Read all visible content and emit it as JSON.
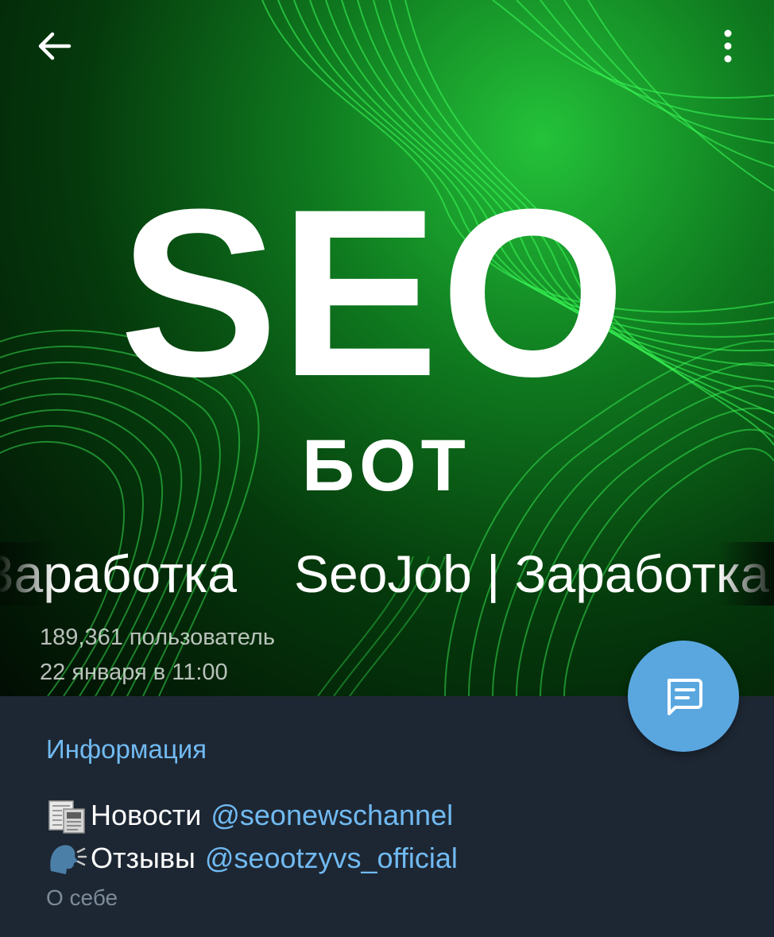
{
  "header": {
    "logo_main": "SEO",
    "logo_sub": "БОТ",
    "title": "SeoJob | Заработка",
    "subscribers": "189,361 пользователь",
    "last_seen": "22 января в 11:00"
  },
  "icons": {
    "back": "arrow-left-icon",
    "menu": "more-vertical-icon",
    "fab": "message-icon",
    "news_emoji": "newspaper-icon",
    "reviews_emoji": "speaking-head-icon"
  },
  "info": {
    "heading": "Информация",
    "news_label": "Новости",
    "news_link": "@seonewschannel",
    "reviews_label": "Отзывы",
    "reviews_link": "@seootzyvs_official",
    "caption": "О себе"
  },
  "colors": {
    "accent": "#71baf2",
    "fab": "#5aa7e0",
    "panel": "#1d2733",
    "brand_green": "#24c23a"
  }
}
